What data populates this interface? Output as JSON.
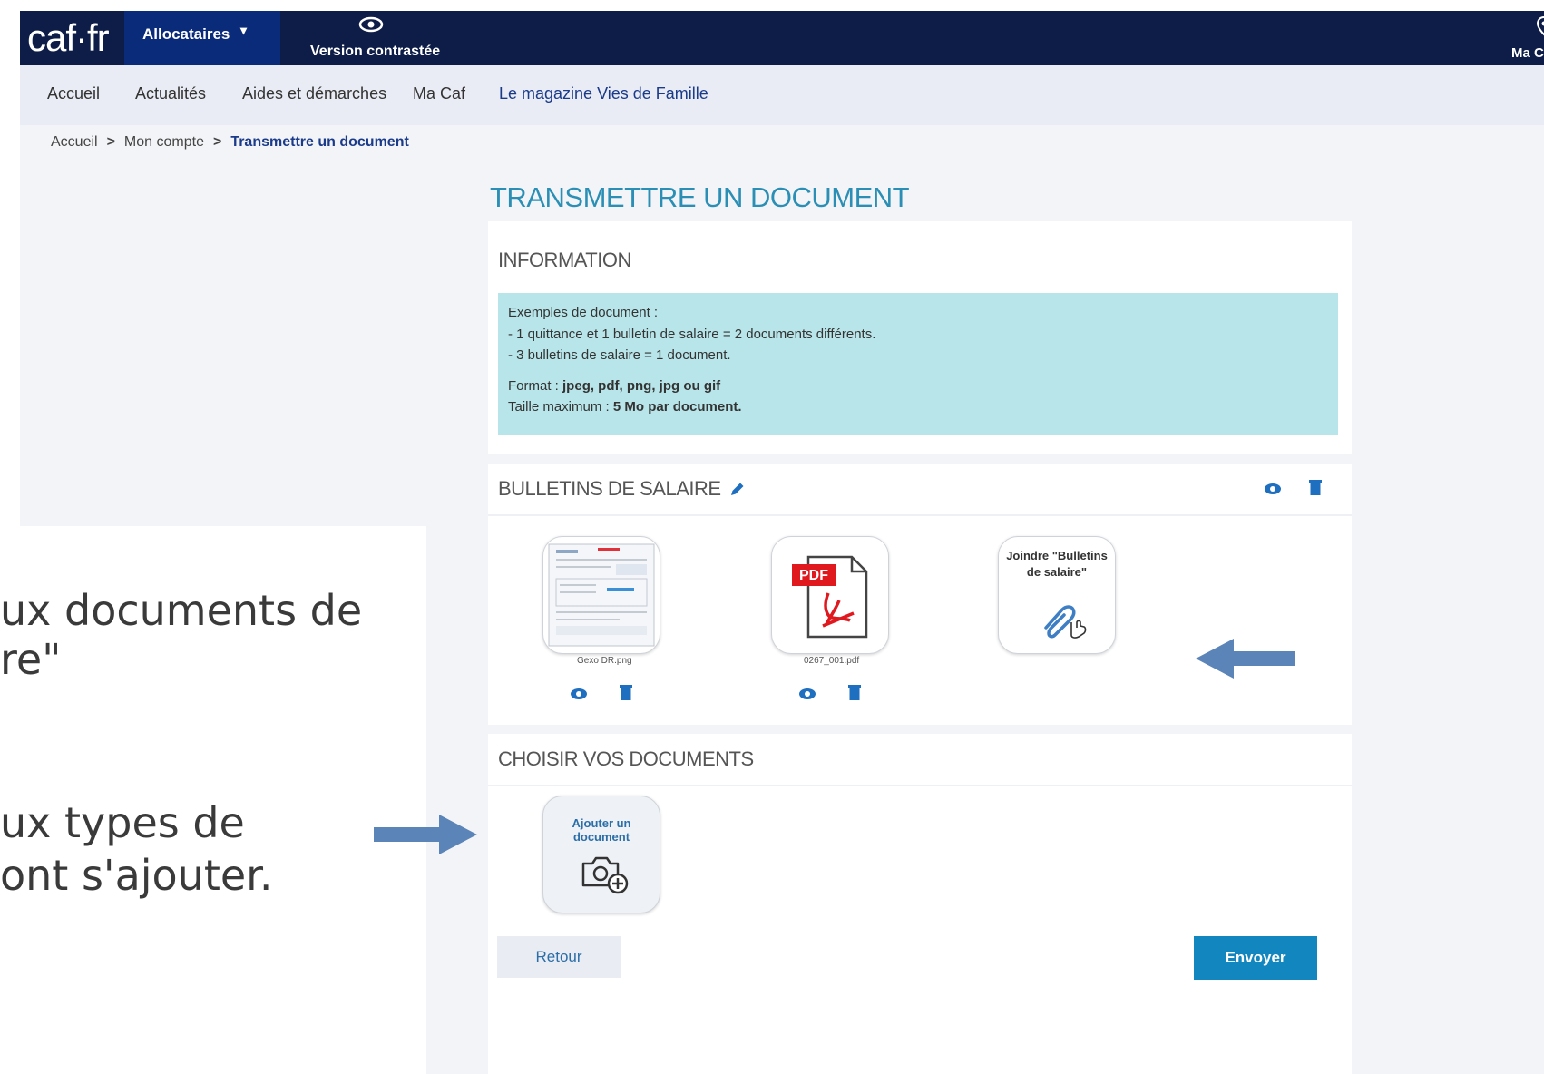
{
  "header": {
    "logo": "caf·fr",
    "allocataires": "Allocataires",
    "contrast": "Version contrastée",
    "macaf": "Ma Caf"
  },
  "nav": [
    "Accueil",
    "Actualités",
    "Aides et démarches",
    "Ma Caf",
    "Le magazine Vies de Famille"
  ],
  "breadcrumb": {
    "item1": "Accueil",
    "item2": "Mon compte",
    "current": "Transmettre un document",
    "separator": ">"
  },
  "page_title": "TRANSMETTRE UN DOCUMENT",
  "information": {
    "title": "INFORMATION",
    "line1": "Exemples de document :",
    "line2": "- 1 quittance et 1 bulletin de salaire = 2 documents différents.",
    "line3": "- 3 bulletins de salaire = 1 document.",
    "format_label": "Format : ",
    "format_value": "jpeg, pdf, png, jpg ou gif",
    "size_label": "Taille maximum : ",
    "size_value": "5 Mo par document."
  },
  "bulletins": {
    "title": "BULLETINS DE SALAIRE",
    "files": [
      "Gexo DR.png",
      "0267_001.pdf"
    ],
    "pdf_badge": "PDF",
    "attach_label": "Joindre \"Bulletins de salaire\""
  },
  "choisir": {
    "title": "CHOISIR VOS DOCUMENTS",
    "add_label": "Ajouter un document"
  },
  "buttons": {
    "retour": "Retour",
    "envoyer": "Envoyer"
  },
  "overlay_text": {
    "line1": "ux documents de",
    "line2": "re\"",
    "line3": "ux types de",
    "line4": "ont s'ajouter."
  },
  "colors": {
    "header": "#0d1d48",
    "accent": "#1186bf",
    "info_bg": "#b8e5e9",
    "arrow": "#5b84b8"
  }
}
